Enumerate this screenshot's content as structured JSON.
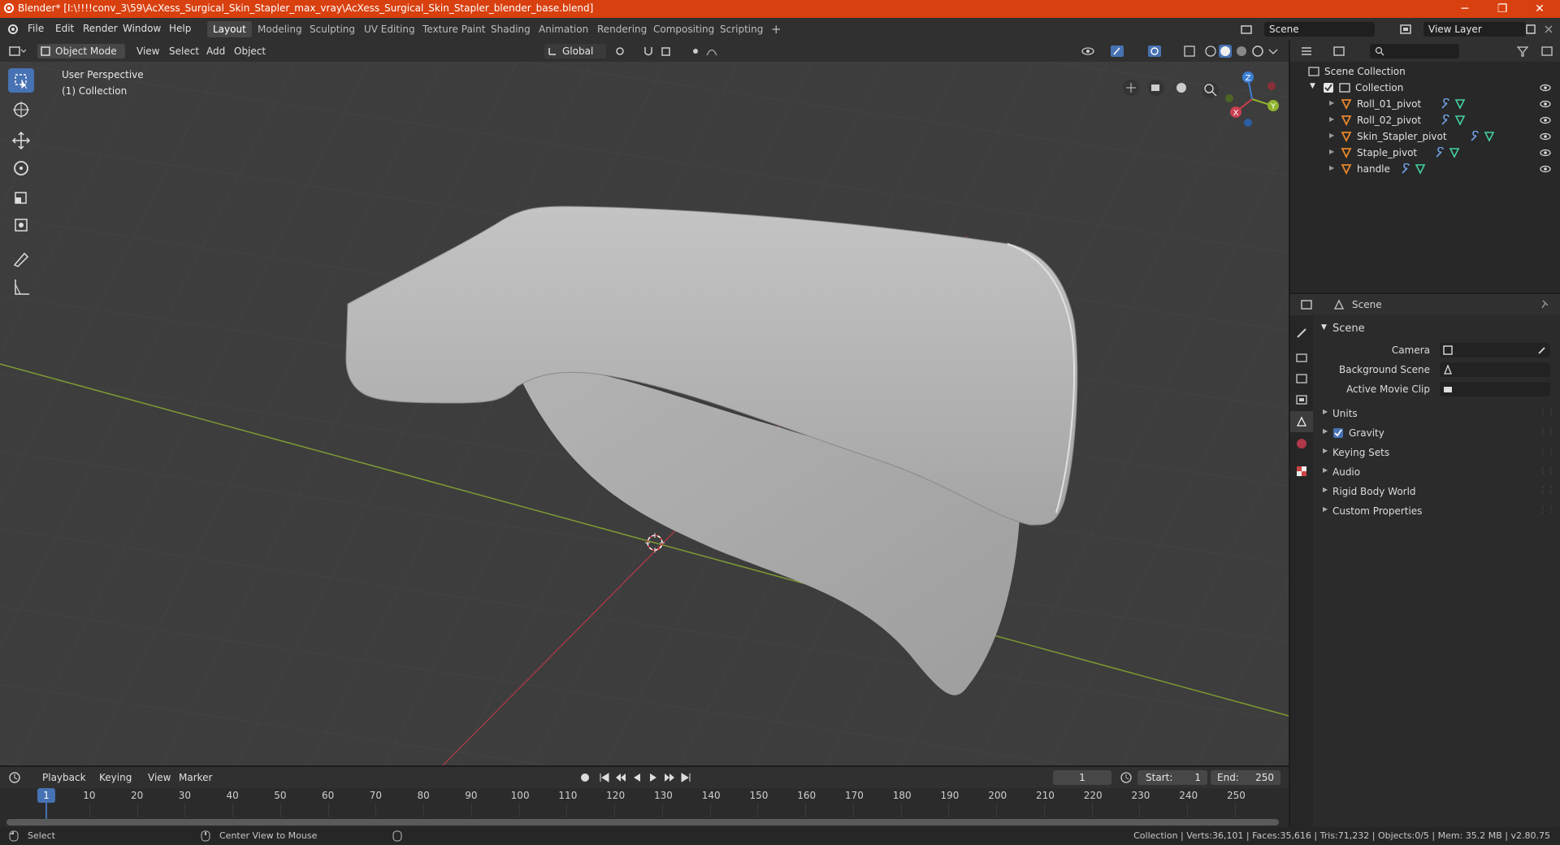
{
  "window": {
    "title": "Blender* [I:\\!!!!conv_3\\59\\AcXess_Surgical_Skin_Stapler_max_vray\\AcXess_Surgical_Skin_Stapler_blender_base.blend]",
    "controls": [
      "─",
      "❐",
      "✕"
    ]
  },
  "menu": [
    "File",
    "Edit",
    "Render",
    "Window",
    "Help"
  ],
  "workspaces": [
    "Layout",
    "Modeling",
    "Sculpting",
    "UV Editing",
    "Texture Paint",
    "Shading",
    "Animation",
    "Rendering",
    "Compositing",
    "Scripting"
  ],
  "active_workspace": "Layout",
  "add_workspace": "+",
  "scene_field": "Scene",
  "view_layer_field": "View Layer",
  "viewport_header": {
    "mode": "Object Mode",
    "menus": [
      "View",
      "Select",
      "Add",
      "Object"
    ],
    "orientation": "Global"
  },
  "viewport": {
    "perspective_label": "User Perspective",
    "collection_label": "(1) Collection",
    "gizmo": {
      "x": "X",
      "y": "Y",
      "z": "Z"
    }
  },
  "toolbar_icons": [
    "select-box-icon",
    "cursor-icon",
    "move-icon",
    "rotate-icon",
    "scale-icon",
    "transform-icon",
    "annotate-icon",
    "measure-icon"
  ],
  "outliner": {
    "search_placeholder": "",
    "root": "Scene Collection",
    "collection": "Collection",
    "items": [
      "Roll_01_pivot",
      "Roll_02_pivot",
      "Skin_Stapler_pivot",
      "Staple_pivot",
      "handle"
    ]
  },
  "properties": {
    "header": "Scene",
    "section": "Scene",
    "camera_label": "Camera",
    "background_scene_label": "Background Scene",
    "active_movie_clip_label": "Active Movie Clip",
    "panels": [
      "Units",
      "Gravity",
      "Keying Sets",
      "Audio",
      "Rigid Body World",
      "Custom Properties"
    ],
    "gravity_checked": true
  },
  "timeline": {
    "menus": [
      "Playback",
      "Keying",
      "View",
      "Marker"
    ],
    "current_frame": "1",
    "start_label": "Start:",
    "start_value": "1",
    "end_label": "End:",
    "end_value": "250",
    "ticks": [
      "1",
      "10",
      "20",
      "30",
      "40",
      "50",
      "60",
      "70",
      "80",
      "90",
      "100",
      "110",
      "120",
      "130",
      "140",
      "150",
      "160",
      "170",
      "180",
      "190",
      "200",
      "210",
      "220",
      "230",
      "240",
      "250"
    ]
  },
  "status": {
    "left_action": "Select",
    "middle_action": "Center View to Mouse",
    "stats": "Collection | Verts:36,101 | Faces:35,616 | Tris:71,232 | Objects:0/5 | Mem: 35.2 MB | v2.80.75"
  },
  "colors": {
    "titlebar": "#d9400f",
    "accent": "#4772b3",
    "x_axis": "#c8404f",
    "y_axis": "#8fb32e",
    "z_axis": "#3b7fd6",
    "object_icon": "#e8872c"
  }
}
